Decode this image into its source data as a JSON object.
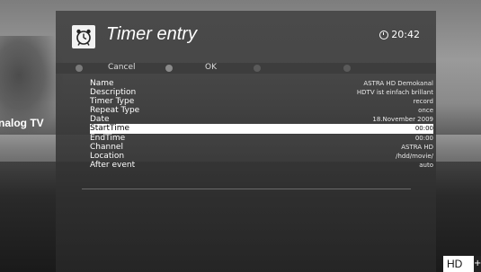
{
  "header": {
    "title": "Timer entry",
    "time": "20:42"
  },
  "toolbar": {
    "cancel_label": "Cancel",
    "ok_label": "OK"
  },
  "side_text": "nalog TV",
  "badge": {
    "hd": "HD",
    "plus": "+"
  },
  "rows": [
    {
      "label": "Name",
      "value": "ASTRA HD Demokanal"
    },
    {
      "label": "Description",
      "value": "HDTV ist einfach brillant"
    },
    {
      "label": "Timer Type",
      "value": "record"
    },
    {
      "label": "Repeat Type",
      "value": "once"
    },
    {
      "label": "Date",
      "value": "18.November 2009"
    },
    {
      "label": "StartTime",
      "value": "00:00"
    },
    {
      "label": "EndTime",
      "value": "00:00"
    },
    {
      "label": "Channel",
      "value": "ASTRA HD"
    },
    {
      "label": "Location",
      "value": "/hdd/movie/"
    },
    {
      "label": "After event",
      "value": "auto"
    }
  ]
}
